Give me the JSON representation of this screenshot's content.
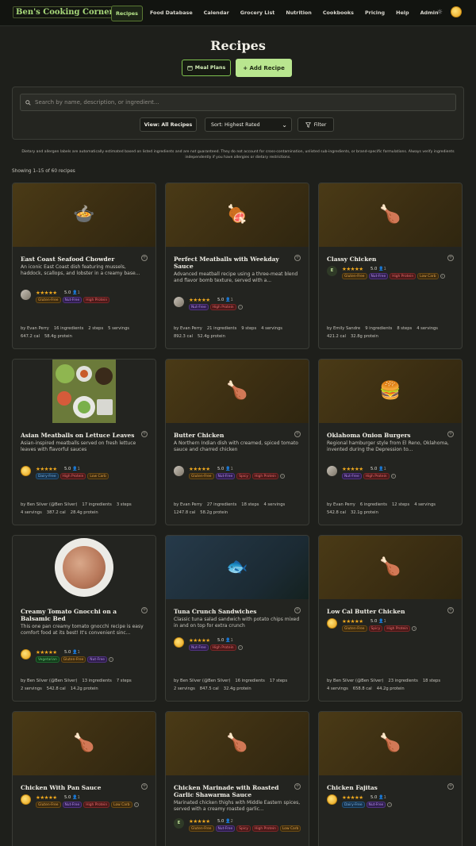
{
  "nav": {
    "brand": "Ben's Cooking Corner",
    "links": [
      "Recipes",
      "Food Database",
      "Calendar",
      "Grocery List",
      "Nutrition",
      "Cookbooks",
      "Pricing",
      "Help",
      "Admin"
    ],
    "active": "Recipes"
  },
  "header": {
    "title": "Recipes",
    "meal_plans_label": "Meal Plans",
    "add_recipe_label": "+ Add Recipe"
  },
  "search": {
    "placeholder": "Search by name, description, or ingredient...",
    "view_label": "View: All Recipes",
    "sort_label": "Sort: Highest Rated",
    "filter_label": "Filter"
  },
  "disclaimer": "Dietary and allergen labels are automatically estimated based on listed ingredients and are not guaranteed. They do not account for cross-contamination, unlisted sub-ingredients, or brand-specific formulations. Always verify ingredients independently if you have allergies or dietary restrictions.",
  "showing": "Showing 1–15 of 60 recipes",
  "recipes": [
    {
      "title": "East Coast Seafood Chowder",
      "desc": "An iconic East Coast dish featuring mussels, haddock, scallops, and lobster in a creamy base...",
      "image_icon": "pot-of-food-icon",
      "rating": "5.0",
      "raters": "1",
      "tags": [
        "Gluten-Free",
        "Nut-Free",
        "High Protein"
      ],
      "author": "by Evan Perry",
      "ingredients": "16 ingredients",
      "steps": "2 steps",
      "servings": "5 servings",
      "cal": "647.2 cal",
      "protein": "58.4g protein"
    },
    {
      "title": "Perfect Meatballs with Weekday Sauce",
      "desc": "Advanced meatball recipe using a three-meat blend and flavor bomb texture, served with a...",
      "image_icon": "meat-on-bone-icon",
      "rating": "5.0",
      "raters": "1",
      "tags": [
        "Nut-Free",
        "High Protein"
      ],
      "author": "by Evan Perry",
      "ingredients": "21 ingredients",
      "steps": "9 steps",
      "servings": "4 servings",
      "cal": "892.3 cal",
      "protein": "52.4g protein"
    },
    {
      "title": "Classy Chicken",
      "desc": "",
      "image_icon": "poultry-leg-icon",
      "rating": "5.0",
      "raters": "1",
      "tags": [
        "Gluten-Free",
        "Nut-Free",
        "High Protein",
        "Low Carb"
      ],
      "author": "by Emily Sandre",
      "ingredients": "9 ingredients",
      "steps": "8 steps",
      "servings": "4 servings",
      "cal": "421.2 cal",
      "protein": "32.8g protein"
    },
    {
      "title": "Asian Meatballs on Lettuce Leaves",
      "desc": "Asian-inspired meatballs served on fresh lettuce leaves with flavorful sauces",
      "image_icon": "photo-plates-icon",
      "rating": "5.0",
      "raters": "1",
      "tags": [
        "Dairy-Free",
        "High Protein",
        "Low Carb"
      ],
      "author": "by Ben Silver (@Ben Silver)",
      "ingredients": "17 ingredients",
      "steps": "3 steps",
      "servings": "4 servings",
      "cal": "387.2 cal",
      "protein": "28.4g protein"
    },
    {
      "title": "Butter Chicken",
      "desc": "A Northern Indian dish with creamed, spiced tomato sauce and charred chicken",
      "image_icon": "poultry-leg-icon",
      "rating": "5.0",
      "raters": "1",
      "tags": [
        "Gluten-Free",
        "Nut-Free",
        "Spicy",
        "High Protein"
      ],
      "author": "by Evan Perry",
      "ingredients": "27 ingredients",
      "steps": "18 steps",
      "servings": "4 servings",
      "cal": "1247.8 cal",
      "protein": "58.2g protein"
    },
    {
      "title": "Oklahoma Onion Burgers",
      "desc": "Regional hamburger style from El Reno, Oklahoma, invented during the Depression to...",
      "image_icon": "hamburger-icon",
      "rating": "5.0",
      "raters": "1",
      "tags": [
        "Nut-Free",
        "High Protein"
      ],
      "author": "by Evan Perry",
      "ingredients": "6 ingredients",
      "steps": "12 steps",
      "servings": "4 servings",
      "cal": "542.8 cal",
      "protein": "32.1g protein"
    },
    {
      "title": "Creamy Tomato Gnocchi on a Balsamic Bed",
      "desc": "This one pan creamy tomato gnocchi recipe is easy comfort food at its best! It's convenient sinc...",
      "image_icon": "photo-bowl-icon",
      "rating": "5.0",
      "raters": "1",
      "tags": [
        "Vegetarian",
        "Gluten-Free",
        "Nut-Free"
      ],
      "author": "by Ben Silver (@Ben Silver)",
      "ingredients": "13 ingredients",
      "steps": "7 steps",
      "servings": "2 servings",
      "cal": "542.8 cal",
      "protein": "14.2g protein"
    },
    {
      "title": "Tuna Crunch Sandwiches",
      "desc": "Classic tuna salad sandwich with potato chips mixed in and on top for extra crunch",
      "image_icon": "fish-icon",
      "rating": "5.0",
      "raters": "1",
      "tags": [
        "Nut-Free",
        "High Protein"
      ],
      "author": "by Ben Silver (@Ben Silver)",
      "ingredients": "16 ingredients",
      "steps": "17 steps",
      "servings": "2 servings",
      "cal": "847.5 cal",
      "protein": "32.4g protein"
    },
    {
      "title": "Low Cal Butter Chicken",
      "desc": "",
      "image_icon": "poultry-leg-icon",
      "rating": "5.0",
      "raters": "1",
      "tags": [
        "Gluten-Free",
        "Spicy",
        "High Protein"
      ],
      "author": "by Ben Silver (@Ben Silver)",
      "ingredients": "23 ingredients",
      "steps": "18 steps",
      "servings": "4 servings",
      "cal": "658.8 cal",
      "protein": "44.2g protein"
    },
    {
      "title": "Chicken With Pan Sauce",
      "desc": "",
      "image_icon": "poultry-leg-icon",
      "rating": "5.0",
      "raters": "1",
      "tags": [
        "Gluten-Free",
        "Nut-Free",
        "High Protein",
        "Low Carb"
      ]
    },
    {
      "title": "Chicken Marinade with Roasted Garlic Shawarma Sauce",
      "desc": "Marinated chicken thighs with Middle Eastern spices, served with a creamy roasted garlic...",
      "image_icon": "poultry-leg-icon",
      "rating": "5.0",
      "raters": "2",
      "tags": [
        "Gluten-Free",
        "Nut-Free",
        "Spicy",
        "High Protein",
        "Low Carb"
      ]
    },
    {
      "title": "Chicken Fajitas",
      "desc": "",
      "image_icon": "poultry-leg-icon",
      "rating": "5.0",
      "raters": "1",
      "tags": [
        "Dairy-Free",
        "Nut-Free"
      ]
    }
  ]
}
